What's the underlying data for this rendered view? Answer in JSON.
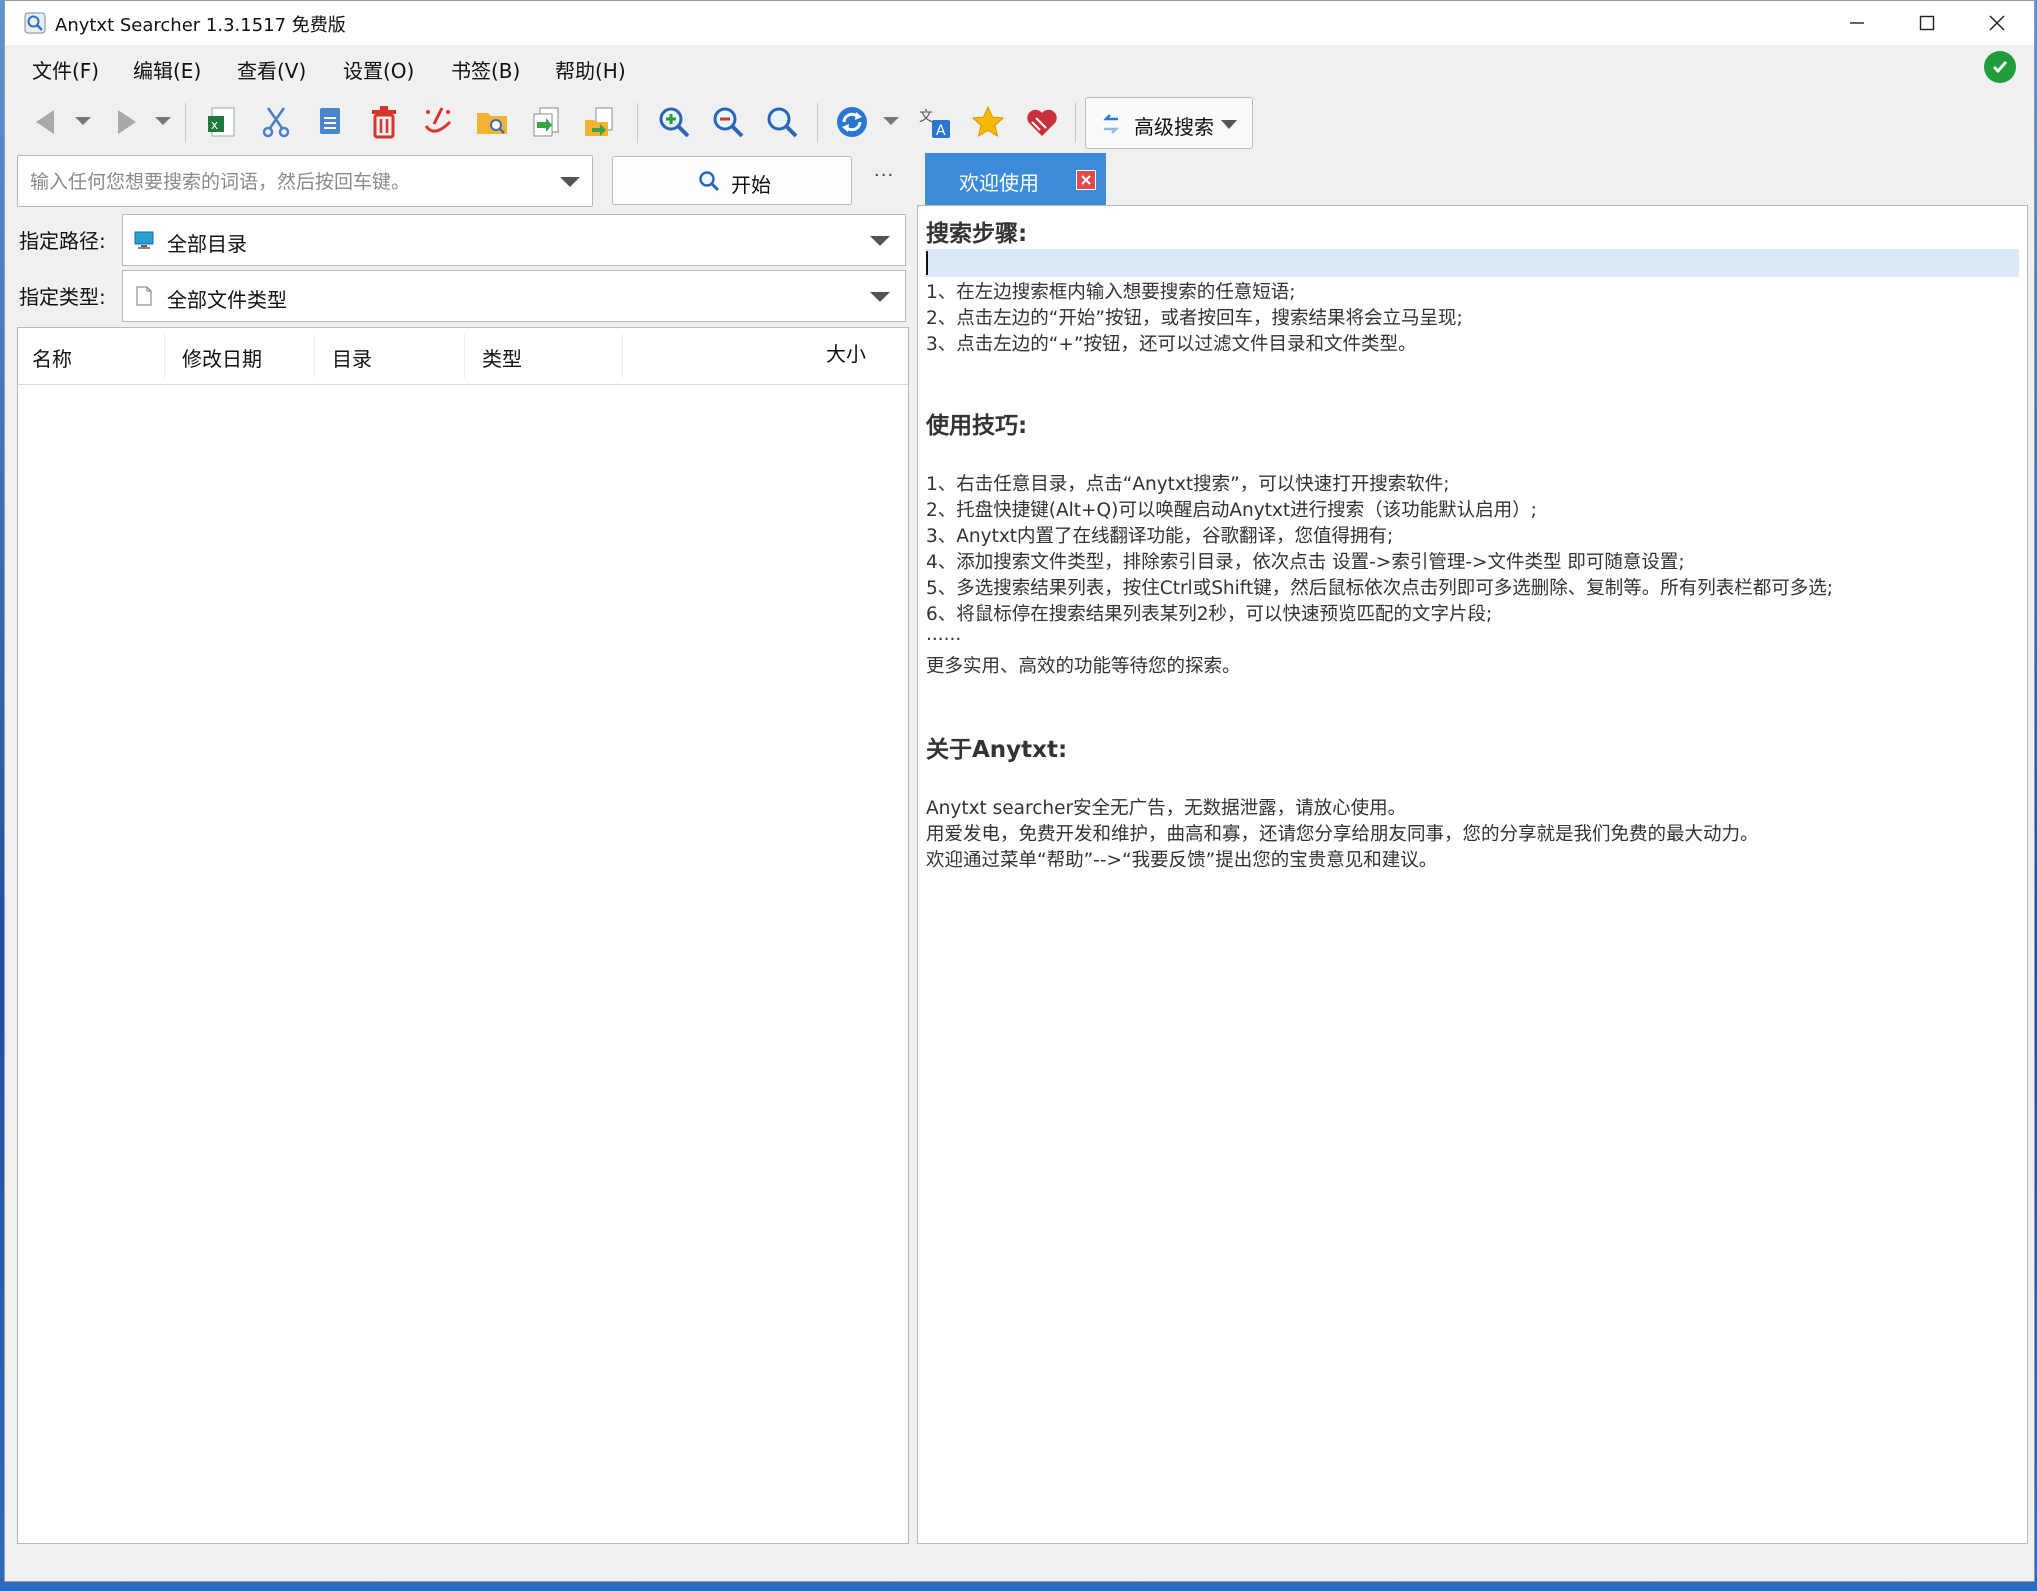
{
  "window": {
    "title": "Anytxt Searcher 1.3.1517 免费版",
    "controls": [
      "minimize-icon",
      "maximize-icon",
      "close-icon"
    ]
  },
  "menu": {
    "items": [
      {
        "label": "文件(F)"
      },
      {
        "label": "编辑(E)"
      },
      {
        "label": "查看(V)"
      },
      {
        "label": "设置(O)"
      },
      {
        "label": "书签(B)"
      },
      {
        "label": "帮助(H)"
      }
    ]
  },
  "toolbar": {
    "icons": [
      "back-icon",
      "back-dropdown-icon",
      "forward-icon",
      "forward-dropdown-icon",
      "excel-export-icon",
      "cut-icon",
      "copy-icon",
      "delete-icon",
      "clean-icon",
      "open-folder-icon",
      "copy-to-icon",
      "move-to-icon",
      "zoom-in-icon",
      "zoom-out-icon",
      "zoom-reset-icon",
      "refresh-icon",
      "refresh-dropdown-icon",
      "translate-icon",
      "bookmark-star-icon",
      "donate-heart-icon"
    ],
    "advanced_search_label": "高级搜索"
  },
  "search": {
    "placeholder": "输入任何您想要搜索的词语，然后按回车键。",
    "value": "",
    "start_label": "开始",
    "more_label": "···"
  },
  "filters": {
    "path_label": "指定路径:",
    "path_value": "全部目录",
    "type_label": "指定类型:",
    "type_value": "全部文件类型"
  },
  "results": {
    "columns": [
      "名称",
      "修改日期",
      "目录",
      "类型",
      "大小"
    ],
    "rows": []
  },
  "tab": {
    "label": "欢迎使用"
  },
  "welcome": {
    "steps_title": "搜索步骤:",
    "steps": [
      "1、在左边搜索框内输入想要搜索的任意短语;",
      "2、点击左边的“开始”按钮，或者按回车，搜索结果将会立马呈现;",
      "3、点击左边的“+”按钮，还可以过滤文件目录和文件类型。"
    ],
    "tips_title": "使用技巧:",
    "tips": [
      "1、右击任意目录，点击“Anytxt搜索”，可以快速打开搜索软件;",
      "2、托盘快捷键(Alt+Q)可以唤醒启动Anytxt进行搜索（该功能默认启用）;",
      "3、Anytxt内置了在线翻译功能，谷歌翻译，您值得拥有;",
      "4、添加搜索文件类型，排除索引目录，依次点击 设置->索引管理->文件类型 即可随意设置;",
      "5、多选搜索结果列表，按住Ctrl或Shift键，然后鼠标依次点击列即可多选删除、复制等。所有列表栏都可多选;",
      "6、将鼠标停在搜索结果列表某列2秒，可以快速预览匹配的文字片段;",
      "......",
      "更多实用、高效的功能等待您的探索。"
    ],
    "about_title": "关于Anytxt:",
    "about": [
      "Anytxt searcher安全无广告，无数据泄露，请放心使用。",
      "用爱发电，免费开发和维护，曲高和寡，还请您分享给朋友同事，您的分享就是我们免费的最大动力。",
      "欢迎通过菜单“帮助”-->“我要反馈”提出您的宝贵意见和建议。"
    ]
  },
  "colors": {
    "accent": "#3c8cd9",
    "status_ok": "#1f9d3a",
    "highlight_row": "#dbe9f6",
    "tab_close": "#e04b4b"
  }
}
